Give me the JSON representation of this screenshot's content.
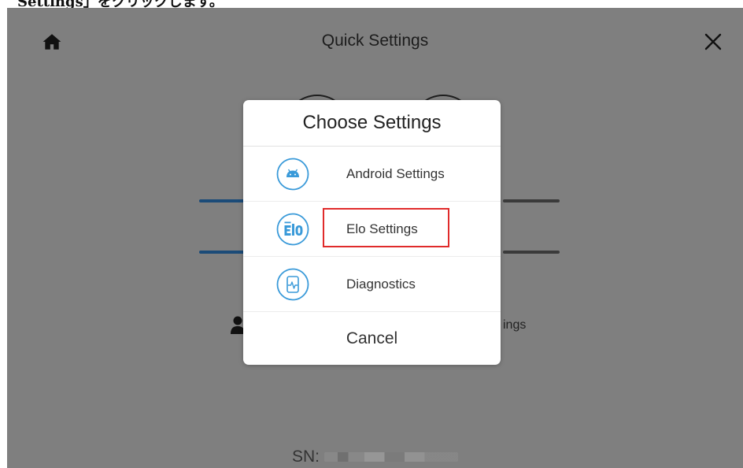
{
  "caption": {
    "text": "Settings」をクリックします。"
  },
  "screen": {
    "title": "Quick Settings",
    "home_icon": "home-icon",
    "close_icon": "close-icon",
    "background_right_text": "ings",
    "serial_label": "SN:"
  },
  "dialog": {
    "title": "Choose Settings",
    "options": [
      {
        "label": "Android Settings",
        "icon": "android-icon"
      },
      {
        "label": "Elo Settings",
        "icon": "elo-logo-icon",
        "highlighted": true
      },
      {
        "label": "Diagnostics",
        "icon": "diagnostics-icon"
      }
    ],
    "cancel_label": "Cancel"
  },
  "colors": {
    "overlay": "#7f7f7f",
    "accent": "#3a9ad9",
    "highlight": "#e02b2b"
  }
}
